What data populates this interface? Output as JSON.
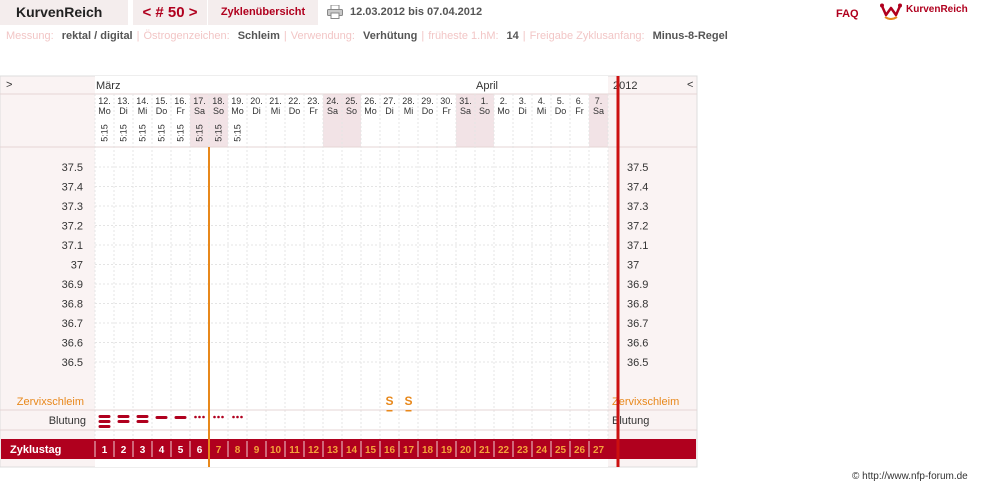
{
  "header": {
    "brand": "KurvenReich",
    "cycle_nav": "< # 50 >",
    "overview_label": "Zyklenübersicht",
    "date_range": "12.03.2012 bis 07.04.2012",
    "faq": "FAQ",
    "logo_text": "KurvenReich"
  },
  "info": [
    {
      "label": "Messung:",
      "value": "rektal / digital"
    },
    {
      "label": "Östrogenzeichen:",
      "value": "Schleim"
    },
    {
      "label": "Verwendung:",
      "value": "Verhütung"
    },
    {
      "label": "früheste 1.hM:",
      "value": "14"
    },
    {
      "label": "Freigabe Zyklusanfang:",
      "value": "Minus-8-Regel"
    }
  ],
  "chart_data": {
    "type": "table",
    "nav_left": ">",
    "nav_right": "<",
    "year": "2012",
    "months": [
      {
        "label": "März",
        "day_index": 0
      },
      {
        "label": "April",
        "day_index": 20
      }
    ],
    "days": [
      {
        "d": "12.",
        "w": "Mo",
        "t": "5:15"
      },
      {
        "d": "13.",
        "w": "Di",
        "t": "5:15"
      },
      {
        "d": "14.",
        "w": "Mi",
        "t": "5:15"
      },
      {
        "d": "15.",
        "w": "Do",
        "t": "5:15"
      },
      {
        "d": "16.",
        "w": "Fr",
        "t": "5:15"
      },
      {
        "d": "17.",
        "w": "Sa",
        "t": "5:15"
      },
      {
        "d": "18.",
        "w": "So",
        "t": "5:15"
      },
      {
        "d": "19.",
        "w": "Mo",
        "t": "5:15"
      },
      {
        "d": "20.",
        "w": "Di",
        "t": ""
      },
      {
        "d": "21.",
        "w": "Mi",
        "t": ""
      },
      {
        "d": "22.",
        "w": "Do",
        "t": ""
      },
      {
        "d": "23.",
        "w": "Fr",
        "t": ""
      },
      {
        "d": "24.",
        "w": "Sa",
        "t": ""
      },
      {
        "d": "25.",
        "w": "So",
        "t": ""
      },
      {
        "d": "26.",
        "w": "Mo",
        "t": ""
      },
      {
        "d": "27.",
        "w": "Di",
        "t": ""
      },
      {
        "d": "28.",
        "w": "Mi",
        "t": ""
      },
      {
        "d": "29.",
        "w": "Do",
        "t": ""
      },
      {
        "d": "30.",
        "w": "Fr",
        "t": ""
      },
      {
        "d": "31.",
        "w": "Sa",
        "t": ""
      },
      {
        "d": "1.",
        "w": "So",
        "t": ""
      },
      {
        "d": "2.",
        "w": "Mo",
        "t": ""
      },
      {
        "d": "3.",
        "w": "Di",
        "t": ""
      },
      {
        "d": "4.",
        "w": "Mi",
        "t": ""
      },
      {
        "d": "5.",
        "w": "Do",
        "t": ""
      },
      {
        "d": "6.",
        "w": "Fr",
        "t": ""
      },
      {
        "d": "7.",
        "w": "Sa",
        "t": ""
      }
    ],
    "y_ticks": [
      "37.5",
      "37.4",
      "37.3",
      "37.2",
      "37.1",
      "37",
      "36.9",
      "36.8",
      "36.7",
      "36.6",
      "36.5"
    ],
    "temperatures": [],
    "cervix_label": "Zervixschleim",
    "cervix": [
      {
        "day_index": 15,
        "symbol": "S"
      },
      {
        "day_index": 16,
        "symbol": "S"
      }
    ],
    "bleeding_label": "Blutung",
    "bleeding": [
      {
        "day_index": 0,
        "level": "heavy"
      },
      {
        "day_index": 1,
        "level": "medium"
      },
      {
        "day_index": 2,
        "level": "medium"
      },
      {
        "day_index": 3,
        "level": "light"
      },
      {
        "day_index": 4,
        "level": "light"
      },
      {
        "day_index": 5,
        "level": "spotting"
      },
      {
        "day_index": 6,
        "level": "spotting"
      },
      {
        "day_index": 7,
        "level": "spotting"
      }
    ],
    "cycle_day_label": "Zyklustag",
    "cycle_days": [
      "1",
      "2",
      "3",
      "4",
      "5",
      "6",
      "7",
      "8",
      "9",
      "10",
      "11",
      "12",
      "13",
      "14",
      "15",
      "16",
      "17",
      "18",
      "19",
      "20",
      "21",
      "22",
      "23",
      "24",
      "25",
      "26",
      "27"
    ],
    "divider_after_day_index": 5
  },
  "colors": {
    "accent": "#b0001e",
    "orange": "#e8881b",
    "weekend": "#f2e3e6",
    "panel": "#faf3f3",
    "label_pink": "#f2c6c6"
  },
  "footer": {
    "credit": "© http://www.nfp-forum.de"
  }
}
